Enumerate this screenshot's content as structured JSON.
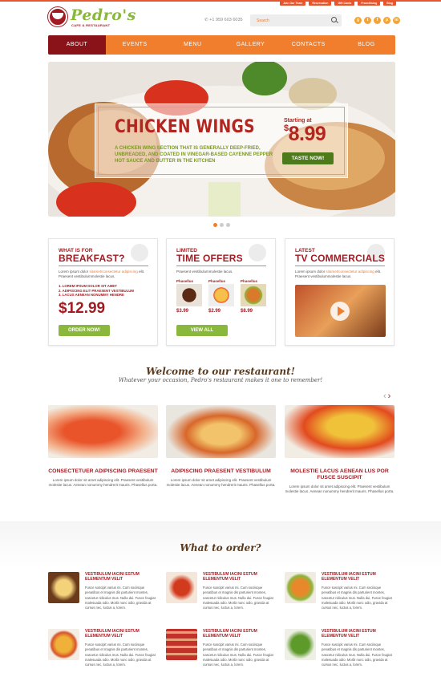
{
  "toplinks": [
    "Join Our Team",
    "Reservation",
    "Gift Cards",
    "Franchising",
    "Blog"
  ],
  "brand": {
    "name": "Pedro's",
    "tagline": "CAFE & RESTAURANT"
  },
  "header": {
    "phone": "+1 959 603 6035",
    "search_placeholder": "Search",
    "socials": [
      "g",
      "t",
      "f",
      "p",
      "in"
    ]
  },
  "nav": [
    "ABOUT",
    "EVENTS",
    "MENU",
    "GALLERY",
    "CONTACTS",
    "BLOG"
  ],
  "hero": {
    "title": "CHICKEN WINGS",
    "text": "A chicken wing section that is generally deep-fried, unbreaded, and coated in vinegar-based cayenne pepper hot sauce and butter in the kitchen",
    "starting_label": "Starting at",
    "currency": "$",
    "price": "8.99",
    "button": "TASTE NOW!",
    "slides": 3,
    "active_slide": 1
  },
  "cards": {
    "breakfast": {
      "sub": "WHAT IS FOR",
      "title": "BREAKFAST?",
      "text_a": "Lorem ipsum dolor ",
      "text_link": "sitamet/consectetur adipiscing",
      "text_b": " elit. Praesent vestibulummolestie lacus.",
      "list": [
        "1. LOREM IPSUM DOLOR SIT AMET",
        "2. ADIPISCING ELIT PRAESENT VESTIBULUM",
        "3. LACUS AENEAN NONUMMY HENDRE"
      ],
      "price": "$12.99",
      "button": "ORDER NOW!"
    },
    "offers": {
      "sub": "LIMITED",
      "title": "TIME OFFERS",
      "text": "Praesent vestibulummolestie lacus.",
      "items": [
        {
          "label": "Phasellus",
          "price": "$3.99"
        },
        {
          "label": "Phasellus",
          "price": "$2.99"
        },
        {
          "label": "Phasellus",
          "price": "$8.99"
        }
      ],
      "button": "VIEW ALL"
    },
    "tv": {
      "sub": "LATEST",
      "title": "TV COMMERCIALS",
      "text_a": "Lorem ipsum dolor ",
      "text_link": "sitamet/consectetur adipiscing",
      "text_b": " elit. Praesent vestibulummolestie lacus."
    }
  },
  "welcome": {
    "title": "Welcome to our restaurant!",
    "subtitle": "Whatever your occasion, Pedro's restaurant makes it one to remember!"
  },
  "features": [
    {
      "title": "CONSECTETUER ADIPISCING PRAESENT",
      "text": "Lorem ipsum dolor sit amet adipiscing elit. Praesent vestibulum molestie lacus. Aenean nonummy hendrerit mauris. Phasellus porta."
    },
    {
      "title": "ADIPISCING PRAESENT VESTIBULUM",
      "text": "Lorem ipsum dolor sit amet adipiscing elit. Praesent vestibulum molestie lacus. Aenean nonummy hendrerit mauris. Phasellus porta."
    },
    {
      "title": "MOLESTIE LACUS AENEAN LUS POR FUSCE SUSCIPIT",
      "text": "Lorem ipsum dolor sit amet adipiscing elit. Praesent vestibulum molestie lacus. Aenean nonummy hendrerit mauris. Phasellus porta."
    }
  ],
  "order": {
    "title": "What to order?",
    "items": [
      {
        "title": "VESTIBULUM IACINI ESTUM ELEMENTUM VELIT",
        "text": "Fusce suscipit varius mi. Cum sociisque penatibus et magnis dis parturient montes, nascetur ridiculus mus. Nulla dui. Fusce feugiat malesuada odio. Morbi nunc odio, gravida at cursus nec, luctus a, lorem."
      },
      {
        "title": "VESTIBULUM IACINI ESTUM ELEMENTUM VELIT",
        "text": "Fusce suscipit varius mi. Cum sociisque penatibus et magnis dis parturient montes, nascetur ridiculus mus. Nulla dui. Fusce feugiat malesuada odio. Morbi nunc odio, gravida at cursus nec, luctus a, lorem."
      },
      {
        "title": "VESTIBULUM IACINI ESTUM ELEMENTUM VELIT",
        "text": "Fusce suscipit varius mi. Cum sociisque penatibus et magnis dis parturient montes, nascetur ridiculus mus. Nulla dui. Fusce feugiat malesuada odio. Morbi nunc odio, gravida at cursus nec, luctus a, lorem."
      },
      {
        "title": "VESTIBULUM IACINI ESTUM ELEMENTUM VELIT",
        "text": "Fusce suscipit varius mi. Cum sociisque penatibus et magnis dis parturient montes, nascetur ridiculus mus. Nulla dui. Fusce feugiat malesuada odio. Morbi nunc odio, gravida at cursus nec, luctus a, lorem."
      },
      {
        "title": "VESTIBULUM IACINI ESTUM ELEMENTUM VELIT",
        "text": "Fusce suscipit varius mi. Cum sociisque penatibus et magnis dis parturient montes, nascetur ridiculus mus. Nulla dui. Fusce feugiat malesuada odio. Morbi nunc odio, gravida at cursus nec, luctus a, lorem."
      },
      {
        "title": "VESTIBULUM IACINI ESTUM ELEMENTUM VELIT",
        "text": "Fusce suscipit varius mi. Cum sociisque penatibus et magnis dis parturient montes, nascetur ridiculus mus. Nulla dui. Fusce feugiat malesuada odio. Morbi nunc odio, gravida at cursus nec, luctus a, lorem."
      }
    ]
  },
  "colors": {
    "accent": "#f07e2d",
    "brand_red": "#a31b22",
    "green": "#8ab83c",
    "nav_active": "#8a1219"
  }
}
